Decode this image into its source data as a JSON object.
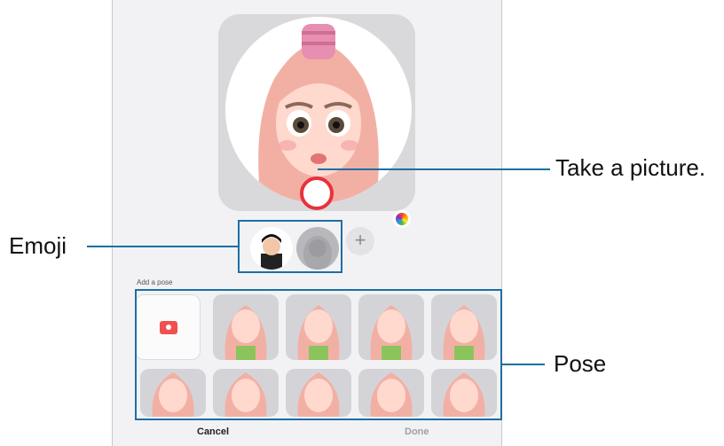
{
  "screen": {
    "add_pose_label": "Add a pose",
    "cancel_label": "Cancel",
    "done_label": "Done",
    "camera_icon": "camera-icon",
    "add_icon": "plus-icon",
    "add_symbol": "+",
    "color_icon": "color-wheel-icon",
    "poses_count": 10
  },
  "callouts": {
    "take_picture": "Take a picture.",
    "emoji": "Emoji",
    "pose": "Pose"
  },
  "colors": {
    "callout": "#1d6fa5",
    "shutter_ring": "#e8323c",
    "camera_icon": "#f0504f",
    "hair": "#f2b0a5",
    "sweater": "#8cc45c"
  }
}
